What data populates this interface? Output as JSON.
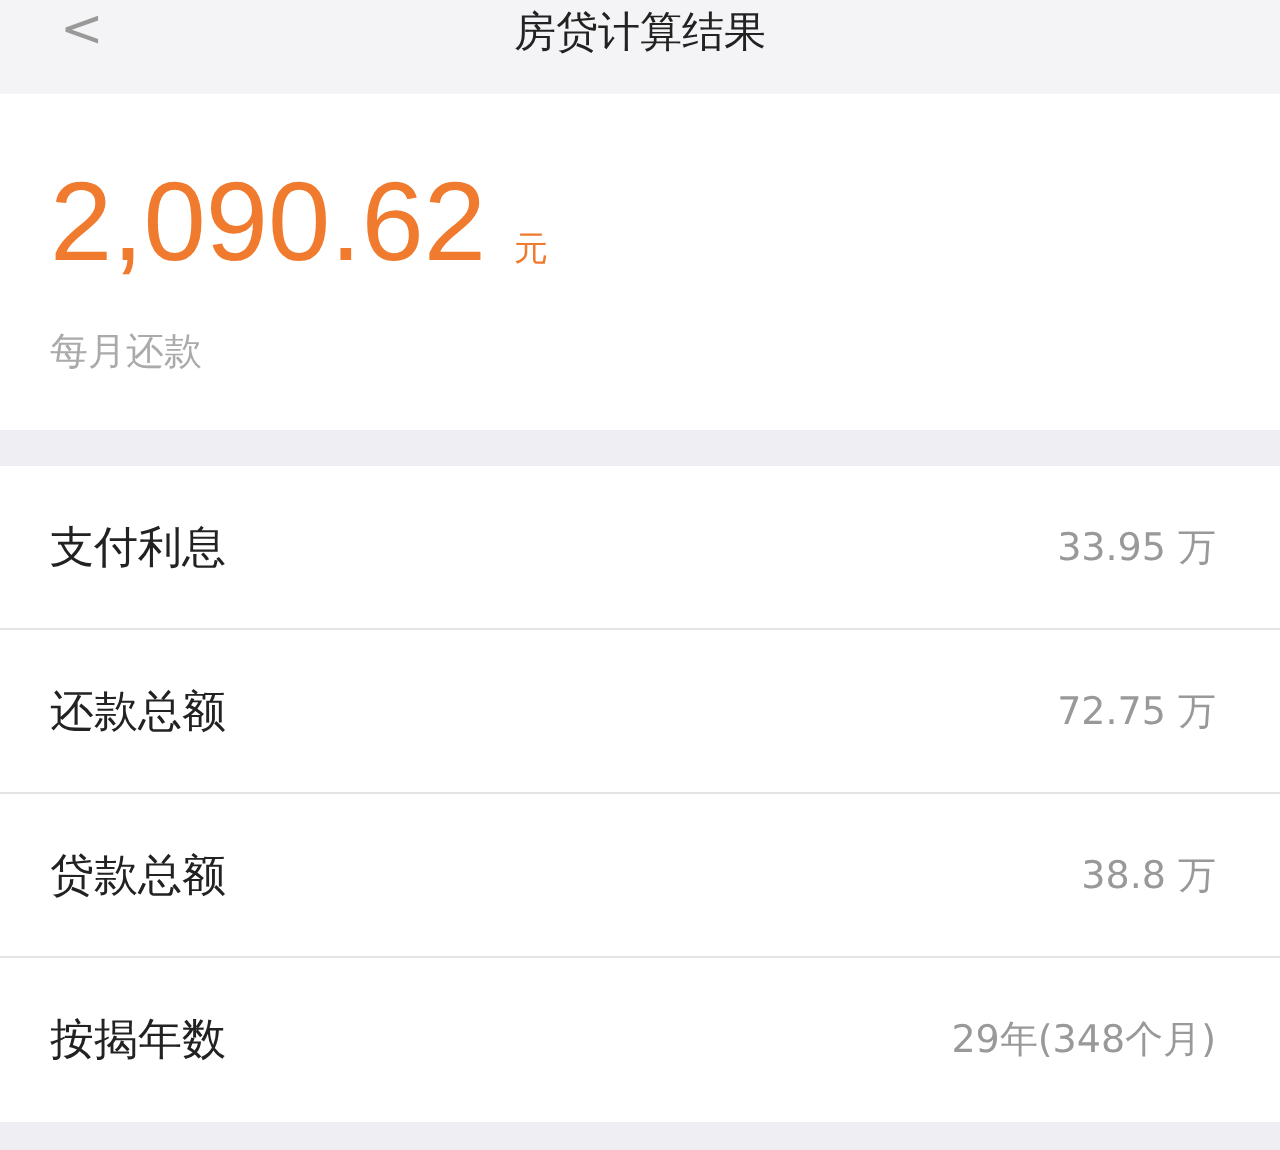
{
  "header": {
    "title": "房贷计算结果",
    "back": "<"
  },
  "summary": {
    "amount": "2,090.62",
    "unit": "元",
    "label": "每月还款"
  },
  "rows": [
    {
      "label": "支付利息",
      "value": "33.95 万"
    },
    {
      "label": "还款总额",
      "value": "72.75 万"
    },
    {
      "label": "贷款总额",
      "value": "38.8 万"
    },
    {
      "label": "按揭年数",
      "value": "29年(348个月)"
    }
  ]
}
